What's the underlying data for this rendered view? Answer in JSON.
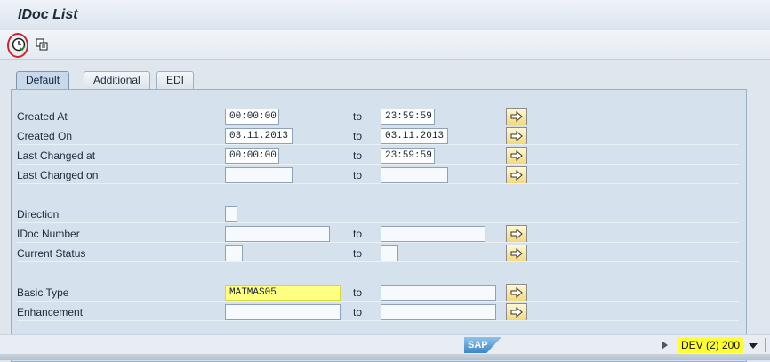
{
  "window": {
    "title": "IDoc List"
  },
  "toolbar": {
    "execute_icon": "clock-execute-icon",
    "multi_icon": "copy-selection-icon"
  },
  "tabs": [
    {
      "label": "Default",
      "active": true
    },
    {
      "label": "Additional",
      "active": false
    },
    {
      "label": "EDI",
      "active": false
    }
  ],
  "fields": [
    {
      "label": "Created At",
      "from": "00:00:00",
      "to": "23:59:59",
      "to_label": "to"
    },
    {
      "label": "Created On",
      "from": "03.11.2013",
      "to": "03.11.2013",
      "to_label": "to"
    },
    {
      "label": "Last Changed at",
      "from": "00:00:00",
      "to": "23:59:59",
      "to_label": "to"
    },
    {
      "label": "Last Changed on",
      "from": "",
      "to": "",
      "to_label": "to"
    },
    {
      "label": "Direction",
      "from": ""
    },
    {
      "label": "IDoc Number",
      "from": "",
      "to": "",
      "to_label": "to"
    },
    {
      "label": "Current Status",
      "from": "",
      "to": "",
      "to_label": "to"
    },
    {
      "label": "Basic Type",
      "from": "MATMAS05",
      "to": "",
      "to_label": "to"
    },
    {
      "label": "Enhancement",
      "from": "",
      "to": "",
      "to_label": "to"
    }
  ],
  "status_bar": {
    "logo": "SAP",
    "system": "DEV (2) 200"
  },
  "colors": {
    "highlight": "#ffff33",
    "annotation": "#d2232a",
    "panel": "#d5e1ec"
  }
}
